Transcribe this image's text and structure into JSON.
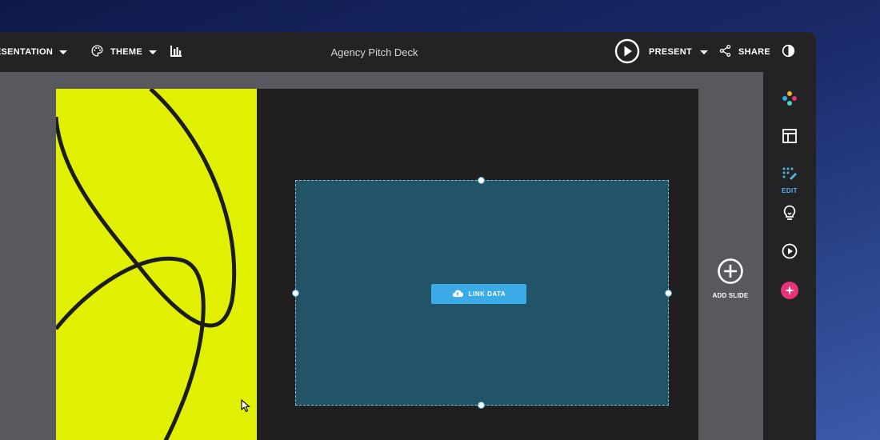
{
  "topbar": {
    "presentation_label": "PRESENTATION",
    "theme_label": "THEME",
    "chart_icon": "bar-chart-icon",
    "doc_title": "Agency Pitch Deck",
    "present_label": "PRESENT",
    "share_label": "SHARE",
    "contrast_icon": "contrast-icon"
  },
  "sidebar": {
    "items": [
      {
        "icon": "color-palette-icon",
        "label": ""
      },
      {
        "icon": "layout-icon",
        "label": ""
      },
      {
        "icon": "edit-magic-icon",
        "label": "EDIT"
      },
      {
        "icon": "lightbulb-icon",
        "label": ""
      },
      {
        "icon": "play-icon",
        "label": ""
      },
      {
        "icon": "ai-sparkle-icon",
        "label": ""
      }
    ]
  },
  "canvas": {
    "link_data_label": "LINK DATA",
    "add_slide_label": "ADD SLIDE"
  },
  "colors": {
    "accent": "#3aabe6",
    "slide_yellow": "#e0f000",
    "ai_pink": "#e8337a"
  }
}
